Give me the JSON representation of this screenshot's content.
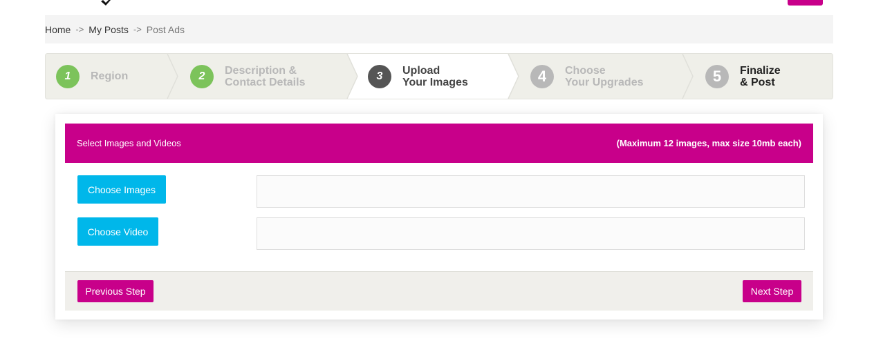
{
  "breadcrumb": {
    "home": "Home",
    "separator": "->",
    "my_posts": "My Posts",
    "current": "Post Ads"
  },
  "steps": [
    {
      "number": "1",
      "line1": "Region",
      "line2": "",
      "state": "done"
    },
    {
      "number": "2",
      "line1": "Description &",
      "line2": "Contact Details",
      "state": "done"
    },
    {
      "number": "3",
      "line1": "Upload",
      "line2": "Your Images",
      "state": "active"
    },
    {
      "number": "4",
      "line1": "Choose",
      "line2": "Your Upgrades",
      "state": "pending"
    },
    {
      "number": "5",
      "line1": "Finalize",
      "line2": "& Post",
      "state": "pending"
    }
  ],
  "upload": {
    "title": "Select Images and Videos",
    "limits": "(Maximum 12 images, max size 10mb each)",
    "choose_images_label": "Choose Images",
    "choose_video_label": "Choose Video"
  },
  "footer": {
    "previous_label": "Previous Step",
    "next_label": "Next Step"
  },
  "colors": {
    "accent": "#c8008a",
    "upload_button": "#00b7ea",
    "step_done": "#7cc35b",
    "step_active": "#555555",
    "step_pending": "#b8b8b8"
  }
}
